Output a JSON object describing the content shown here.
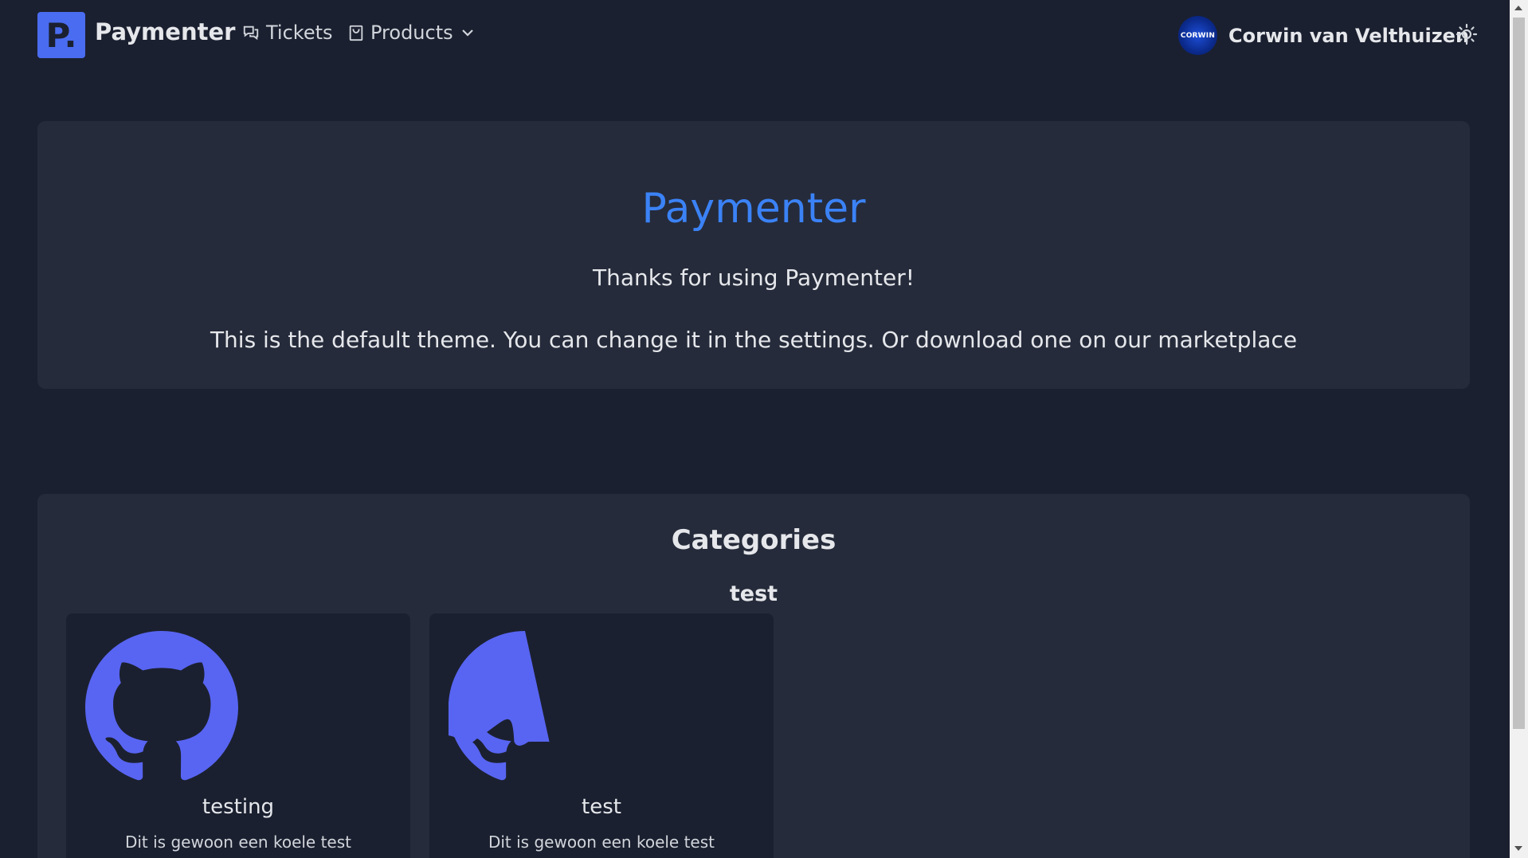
{
  "header": {
    "logo_letter": "P.",
    "brand": "Paymenter",
    "nav": {
      "tickets_label": "Tickets",
      "products_label": "Products"
    },
    "user": {
      "avatar_text": "CORWIN",
      "name": "Corwin van Velthuizen"
    }
  },
  "hero": {
    "title": "Paymenter",
    "line1": "Thanks for using Paymenter!",
    "line2": "This is the default theme. You can change it in the settings. Or download one on our marketplace"
  },
  "categories": {
    "title": "Categories",
    "group_name": "test",
    "products": [
      {
        "name": "testing",
        "description": "Dit is gewoon een koele test",
        "icon": "github-icon"
      },
      {
        "name": "test",
        "description": "Dit is gewoon een koele test",
        "icon": "github-icon"
      }
    ]
  },
  "colors": {
    "background": "#1b2030",
    "card": "#252b3a",
    "accent": "#4a6cf0",
    "hero_title": "#3b82f6",
    "github_icon": "#5865f2"
  }
}
